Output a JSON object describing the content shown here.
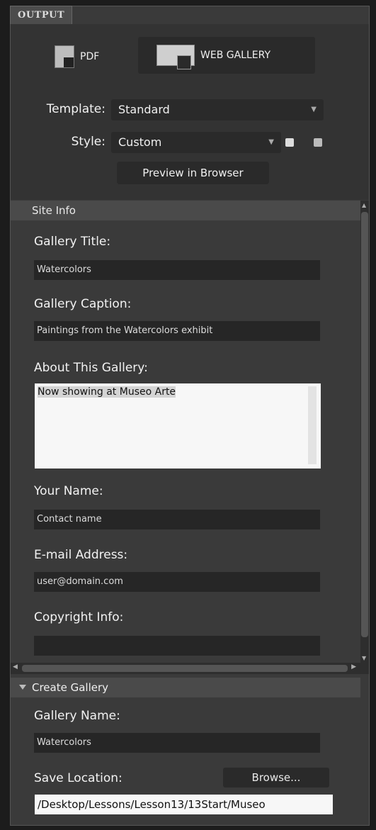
{
  "panel": {
    "tab_title": "OUTPUT",
    "modes": [
      {
        "label": "PDF",
        "icon": "pdf-document-icon"
      },
      {
        "label": "WEB GALLERY",
        "icon": "web-gallery-icon"
      }
    ]
  },
  "settings": {
    "template_label": "Template:",
    "template_value": "Standard",
    "style_label": "Style:",
    "style_value": "Custom",
    "preview_button": "Preview in Browser"
  },
  "site_info": {
    "header": "Site Info",
    "gallery_title_label": "Gallery Title:",
    "gallery_title_value": "Watercolors",
    "gallery_caption_label": "Gallery Caption:",
    "gallery_caption_value": "Paintings from the Watercolors exhibit",
    "about_label": "About This Gallery:",
    "about_value": "Now showing at Museo Arte",
    "your_name_label": "Your Name:",
    "your_name_value": "Contact name",
    "email_label": "E-mail Address:",
    "email_value": "user@domain.com",
    "copyright_label": "Copyright Info:",
    "copyright_value": ""
  },
  "create_gallery": {
    "header": "Create Gallery",
    "gallery_name_label": "Gallery Name:",
    "gallery_name_value": "Watercolors",
    "save_location_label": "Save Location:",
    "browse_button": "Browse...",
    "save_location_value": "/Desktop/Lessons/Lesson13/13Start/Museo"
  }
}
